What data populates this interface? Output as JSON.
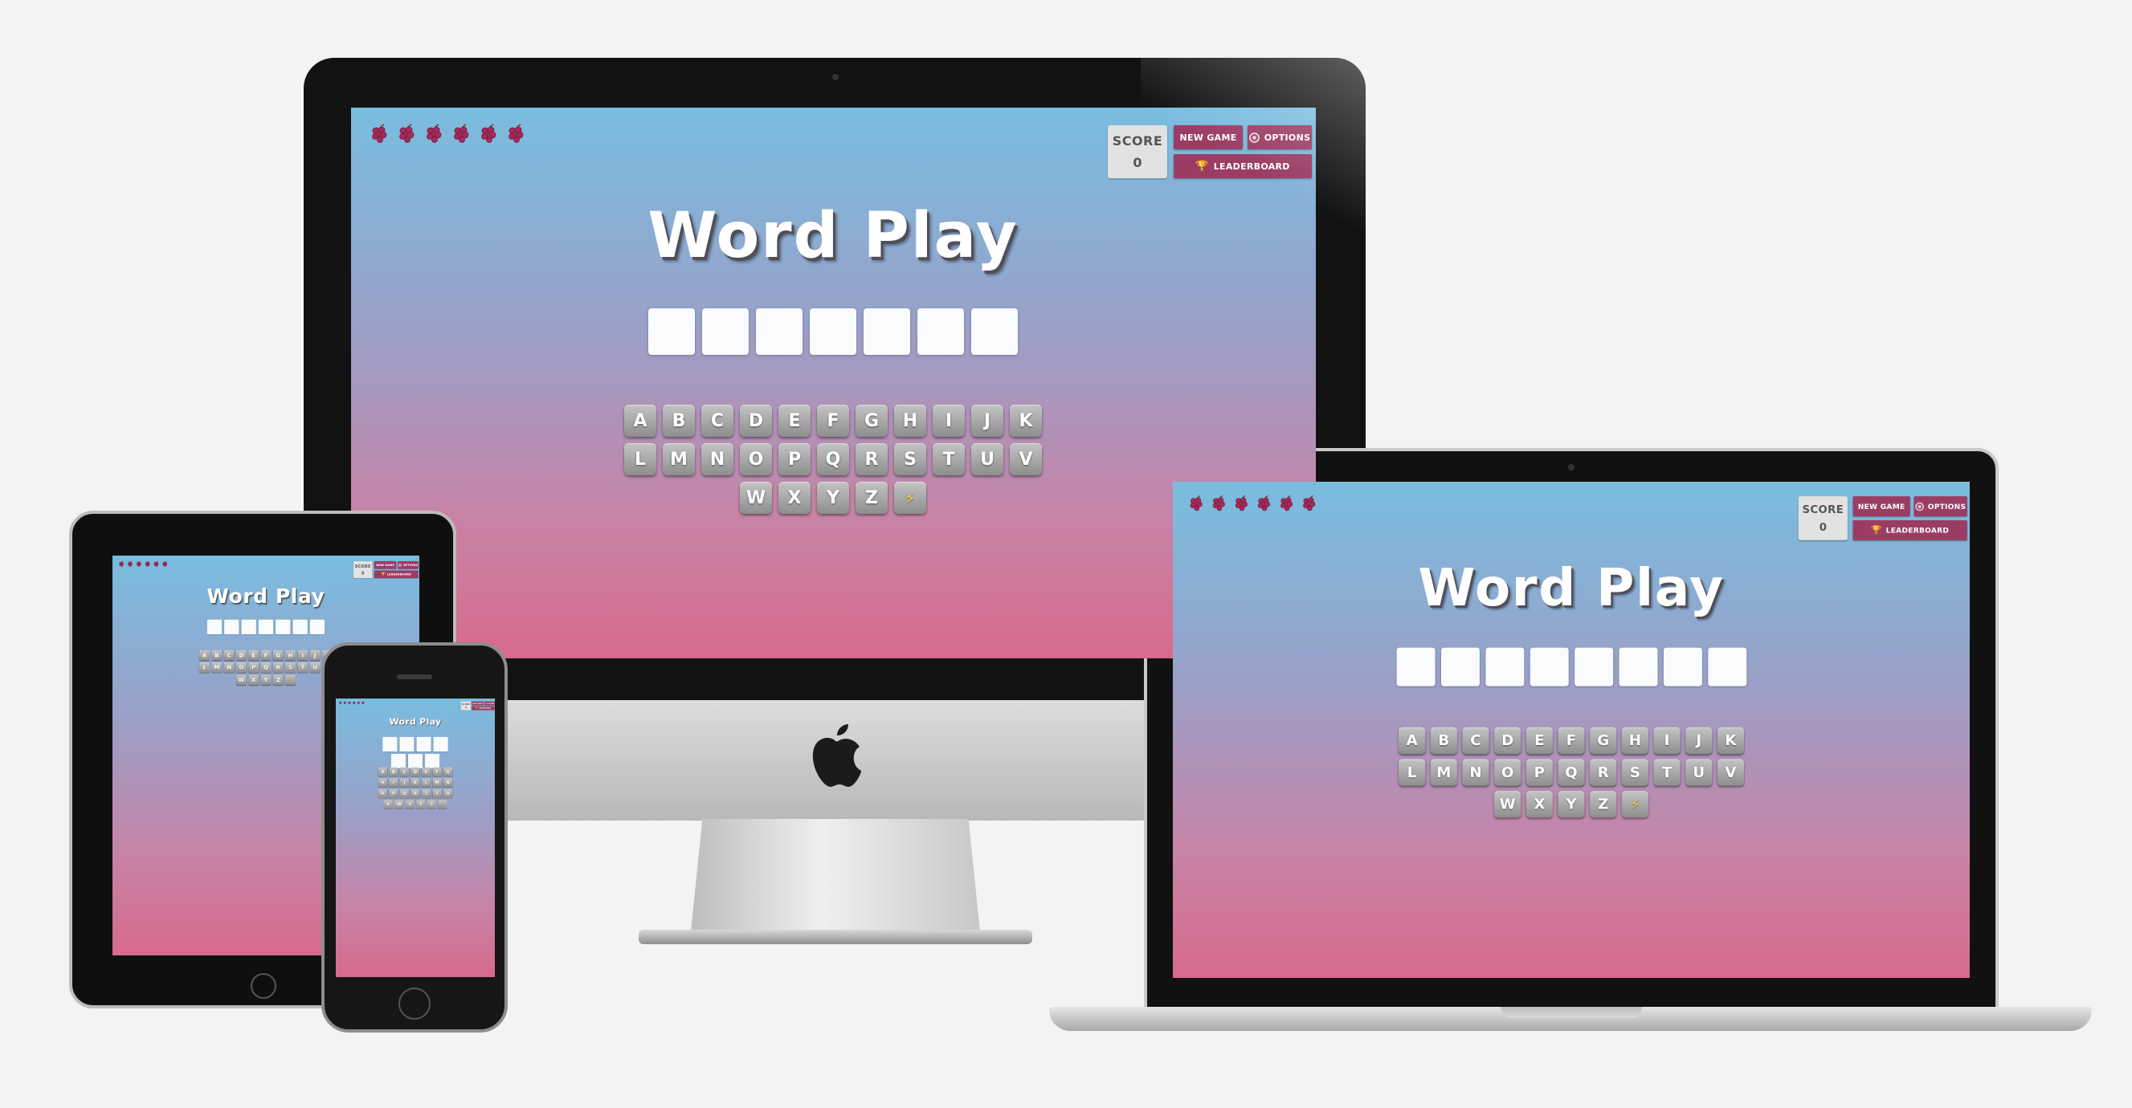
{
  "app": {
    "title": "Word Play",
    "score_label": "SCORE",
    "score_value": "0",
    "new_game_label": "NEW GAME",
    "options_label": "OPTIONS",
    "leaderboard_label": "LEADERBOARD",
    "lives_count": 6,
    "lives_icon": "grapes-icon",
    "accent_color": "#9b3c64"
  },
  "desktop": {
    "slots": 7,
    "keyboard_rows": [
      [
        "A",
        "B",
        "C",
        "D",
        "E",
        "F",
        "G",
        "H",
        "I",
        "J",
        "K"
      ],
      [
        "L",
        "M",
        "N",
        "O",
        "P",
        "Q",
        "R",
        "S",
        "T",
        "U",
        "V"
      ],
      [
        "W",
        "X",
        "Y",
        "Z",
        "⚡"
      ]
    ]
  },
  "laptop": {
    "slots": 8
  },
  "phone": {
    "slots": 7,
    "keyboard_rows": [
      [
        "A",
        "B",
        "C",
        "D",
        "E",
        "F",
        "G"
      ],
      [
        "H",
        "I",
        "J",
        "K",
        "L",
        "M",
        "N"
      ],
      [
        "O",
        "P",
        "Q",
        "R",
        "S",
        "T",
        "U"
      ],
      [
        "V",
        "W",
        "X",
        "Y",
        "Z",
        "⚡"
      ]
    ]
  }
}
